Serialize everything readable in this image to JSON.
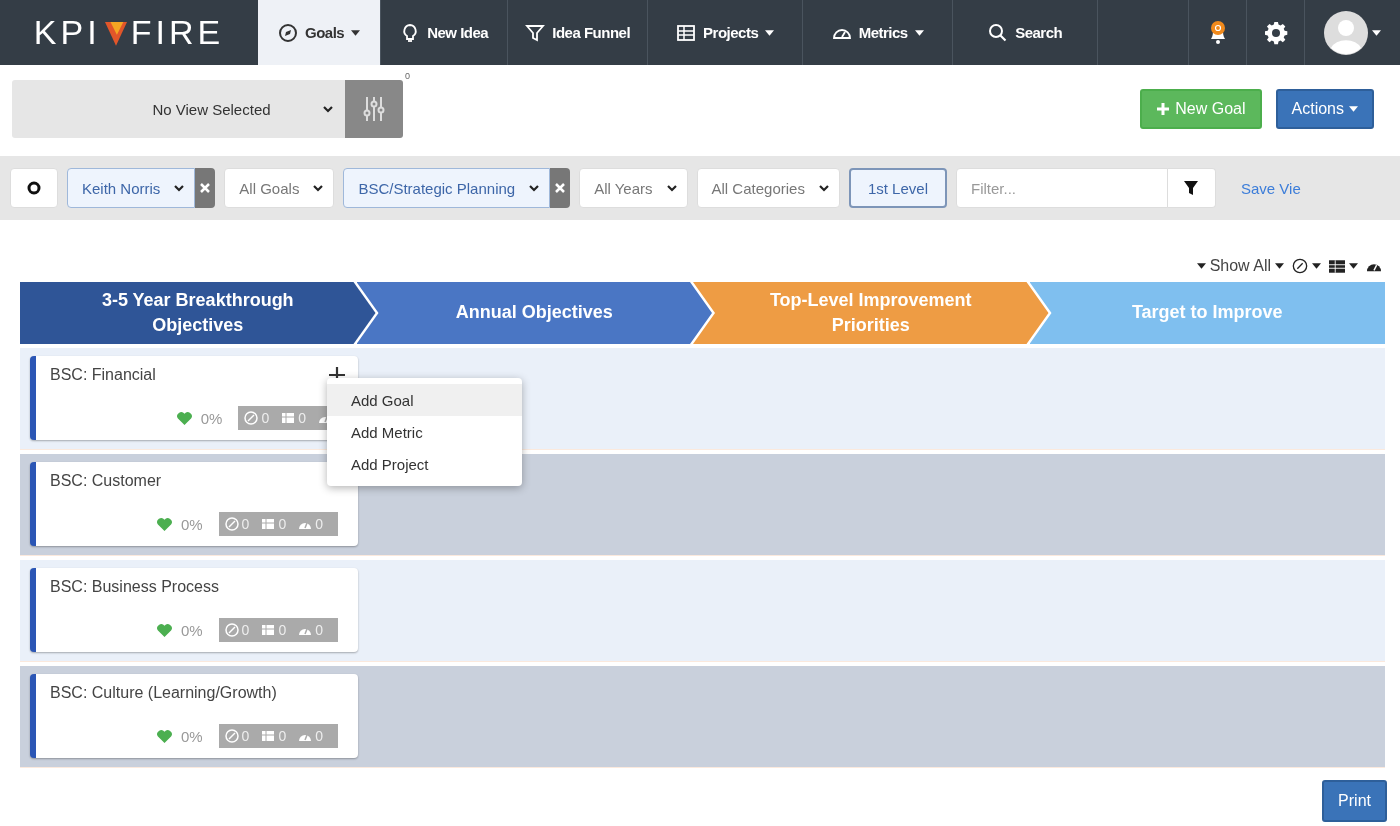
{
  "navbar": {
    "logo": {
      "left": "KPI",
      "right": "FIRE"
    },
    "items": [
      {
        "kind": "goals",
        "label": "Goals",
        "caret": true,
        "selected": true
      },
      {
        "kind": "idea",
        "label": "New Idea",
        "caret": false,
        "selected": false
      },
      {
        "kind": "funnel",
        "label": "Idea Funnel",
        "caret": false,
        "selected": false
      },
      {
        "kind": "projects",
        "label": "Projects",
        "caret": true,
        "selected": false
      },
      {
        "kind": "metrics",
        "label": "Metrics",
        "caret": true,
        "selected": false
      },
      {
        "kind": "search",
        "label": "Search",
        "caret": false,
        "selected": false
      }
    ]
  },
  "view_bar": {
    "view_select": "No View Selected",
    "settings_badge": "0",
    "buttons": [
      {
        "kind": "new",
        "label": "New Goal"
      },
      {
        "kind": "actions",
        "label": "Actions"
      }
    ]
  },
  "filters": [
    {
      "kind": "toggle"
    },
    {
      "kind": "select",
      "label": "Keith Norris",
      "active": true
    },
    {
      "kind": "select",
      "label": "All Goals",
      "active": false
    },
    {
      "kind": "select",
      "label": "BSC/Strategic Planning",
      "active": true
    },
    {
      "kind": "select",
      "label": "All Years",
      "active": false
    },
    {
      "kind": "select",
      "label": "All Categories",
      "active": false
    },
    {
      "kind": "level",
      "label": "1st Level",
      "selected": true
    },
    {
      "kind": "search",
      "placeholder": "Filter..."
    },
    {
      "kind": "link",
      "label": "Save Vie"
    }
  ],
  "view_options": {
    "show": "Show All"
  },
  "stages": [
    {
      "label": "3-5 Year Breakthrough Objectives",
      "color": "#2f5597"
    },
    {
      "label": "Annual Objectives",
      "color": "#4a76c4"
    },
    {
      "label": "Top-Level Improvement Priorities",
      "color": "#ee9c44"
    },
    {
      "label": "Target to Improve",
      "color": "#7fbfef"
    }
  ],
  "goals": [
    {
      "title": "BSC: Financial",
      "percent": "0%",
      "counts": [
        "0",
        "0"
      ]
    },
    {
      "title": "BSC: Customer",
      "percent": "0%",
      "counts": [
        "0",
        "0",
        "0"
      ]
    },
    {
      "title": "BSC: Business Process",
      "percent": "0%",
      "counts": [
        "0",
        "0",
        "0"
      ]
    },
    {
      "title": "BSC: Culture (Learning/Growth)",
      "percent": "0%",
      "counts": [
        "0",
        "0",
        "0"
      ]
    }
  ],
  "add_menu": {
    "items": [
      {
        "label": "Add Goal",
        "highlighted": true
      },
      {
        "label": "Add Metric",
        "highlighted": false
      },
      {
        "label": "Add Project",
        "highlighted": false
      }
    ]
  },
  "print_button": "Print"
}
